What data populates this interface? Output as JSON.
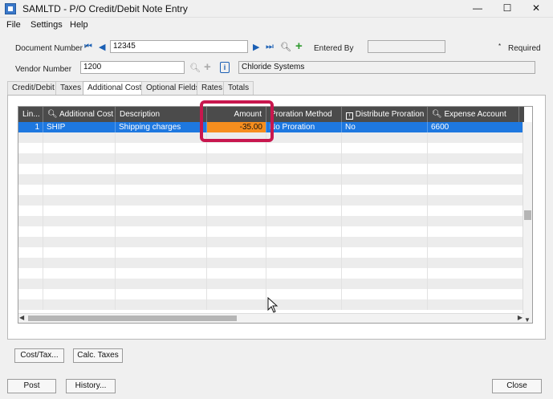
{
  "window": {
    "title": "SAMLTD - P/O Credit/Debit Note Entry",
    "minimize": "—",
    "maximize": "☐",
    "close": "✕"
  },
  "menu": [
    "File",
    "Settings",
    "Help"
  ],
  "header": {
    "document_number_label": "Document Number",
    "document_number_value": "12345",
    "entered_by_label": "Entered By",
    "entered_by_value": "",
    "required_label": "Required",
    "vendor_number_label": "Vendor Number",
    "vendor_number_value": "1200",
    "vendor_name_value": "Chloride Systems"
  },
  "tabs": [
    "Credit/Debit",
    "Taxes",
    "Additional Costs",
    "Optional Fields",
    "Rates",
    "Totals"
  ],
  "grid": {
    "columns": [
      "Lin...",
      "Additional Cost",
      "Description",
      "Amount",
      "Proration Method",
      "Distribute Proration",
      "Expense Account"
    ],
    "rows": [
      {
        "line": "1",
        "additional_cost": "SHIP",
        "description": "Shipping charges",
        "amount": "-35.00",
        "proration_method": "No Proration",
        "distribute_proration": "No",
        "expense_account": "6600"
      }
    ]
  },
  "buttons": {
    "cost_tax": "Cost/Tax...",
    "calc_taxes": "Calc. Taxes",
    "post": "Post",
    "history": "History...",
    "close": "Close"
  },
  "colors": {
    "selected_row": "#1e78e0",
    "amount_highlight": "#f68e1e",
    "annotation_border": "#c8174e"
  }
}
